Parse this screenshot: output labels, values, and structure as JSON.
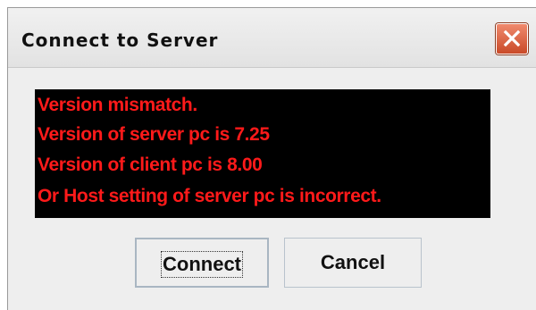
{
  "window": {
    "title": "Connect to Server",
    "close_icon": "close-icon",
    "accent_color": "#d4532f"
  },
  "message": {
    "text_color": "#ff1a1a",
    "background_color": "#000000",
    "lines": [
      "Version mismatch.",
      "Version of server pc is 7.25",
      "Version of client pc is 8.00",
      "Or Host setting of server pc is incorrect."
    ]
  },
  "buttons": {
    "connect_label": "Connect",
    "cancel_label": "Cancel"
  }
}
